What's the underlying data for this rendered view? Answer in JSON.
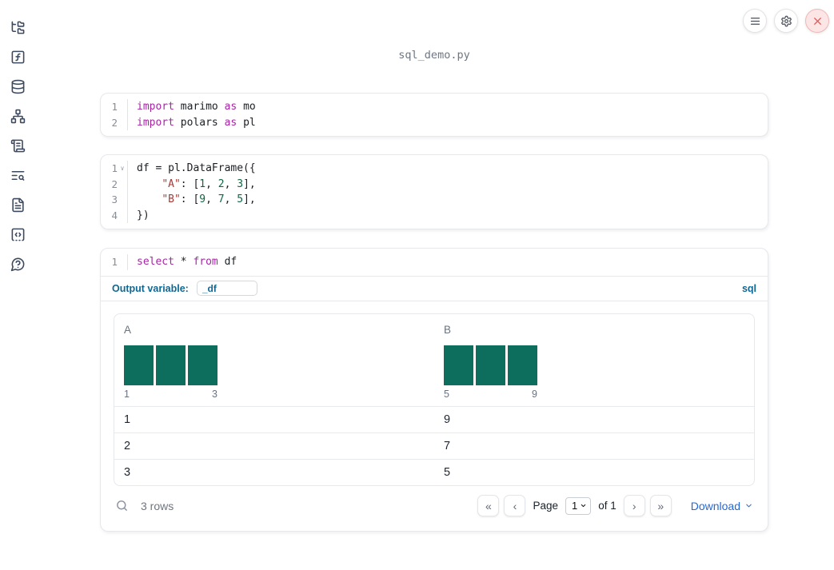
{
  "title": "sql_demo.py",
  "topbar": {
    "buttons": [
      {
        "icon": "hamburger-menu-icon"
      },
      {
        "icon": "gear-icon"
      },
      {
        "icon": "close-icon"
      }
    ]
  },
  "sidebar": {
    "icons": [
      "file-tree-icon",
      "function-square-icon",
      "database-icon",
      "dependency-graph-icon",
      "scroll-icon",
      "list-search-icon",
      "document-icon",
      "code-snippet-icon",
      "help-bubble-icon"
    ]
  },
  "cells": [
    {
      "name": "imports",
      "lines": [
        {
          "num": "1",
          "tokens": [
            [
              "kw",
              "import"
            ],
            [
              "p",
              " marimo "
            ],
            [
              "kw",
              "as"
            ],
            [
              "p",
              " mo"
            ]
          ]
        },
        {
          "num": "2",
          "tokens": [
            [
              "kw",
              "import"
            ],
            [
              "p",
              " polars "
            ],
            [
              "kw",
              "as"
            ],
            [
              "p",
              " pl"
            ]
          ]
        }
      ]
    },
    {
      "name": "dataframe",
      "lines": [
        {
          "num": "1",
          "fold": true,
          "tokens": [
            [
              "p",
              "df = pl.DataFrame({"
            ]
          ]
        },
        {
          "num": "2",
          "tokens": [
            [
              "p",
              "    "
            ],
            [
              "str",
              "\"A\""
            ],
            [
              "p",
              ": ["
            ],
            [
              "num",
              "1"
            ],
            [
              "p",
              ", "
            ],
            [
              "num",
              "2"
            ],
            [
              "p",
              ", "
            ],
            [
              "num",
              "3"
            ],
            [
              "p",
              "],"
            ]
          ]
        },
        {
          "num": "3",
          "tokens": [
            [
              "p",
              "    "
            ],
            [
              "str",
              "\"B\""
            ],
            [
              "p",
              ": ["
            ],
            [
              "num",
              "9"
            ],
            [
              "p",
              ", "
            ],
            [
              "num",
              "7"
            ],
            [
              "p",
              ", "
            ],
            [
              "num",
              "5"
            ],
            [
              "p",
              "],"
            ]
          ]
        },
        {
          "num": "4",
          "tokens": [
            [
              "p",
              "})"
            ]
          ]
        }
      ]
    },
    {
      "name": "sql",
      "lines": [
        {
          "num": "1",
          "tokens": [
            [
              "kw",
              "select"
            ],
            [
              "p",
              " * "
            ],
            [
              "kw",
              "from"
            ],
            [
              "p",
              " df"
            ]
          ]
        }
      ],
      "footer": {
        "label": "Output variable:",
        "value": "_df",
        "language": "sql"
      }
    }
  ],
  "table": {
    "columns": [
      {
        "header": "A",
        "hist": {
          "bars": [
            1,
            1,
            1
          ],
          "min_label": "1",
          "max_label": "3"
        }
      },
      {
        "header": "B",
        "hist": {
          "bars": [
            1,
            1,
            1
          ],
          "min_label": "5",
          "max_label": "9"
        }
      }
    ],
    "rows": [
      [
        "1",
        "9"
      ],
      [
        "2",
        "7"
      ],
      [
        "3",
        "5"
      ]
    ],
    "row_count": "3 rows",
    "pagination": {
      "first_glyph": "«",
      "prev_glyph": "‹",
      "next_glyph": "›",
      "last_glyph": "»",
      "page_label": "Page",
      "page_value": "1",
      "of_label": "of 1"
    },
    "download_label": "Download"
  },
  "colors": {
    "histogram_bar": "#0e6e5e",
    "accent_blue": "#0e6894",
    "link_blue": "#2468d9"
  }
}
